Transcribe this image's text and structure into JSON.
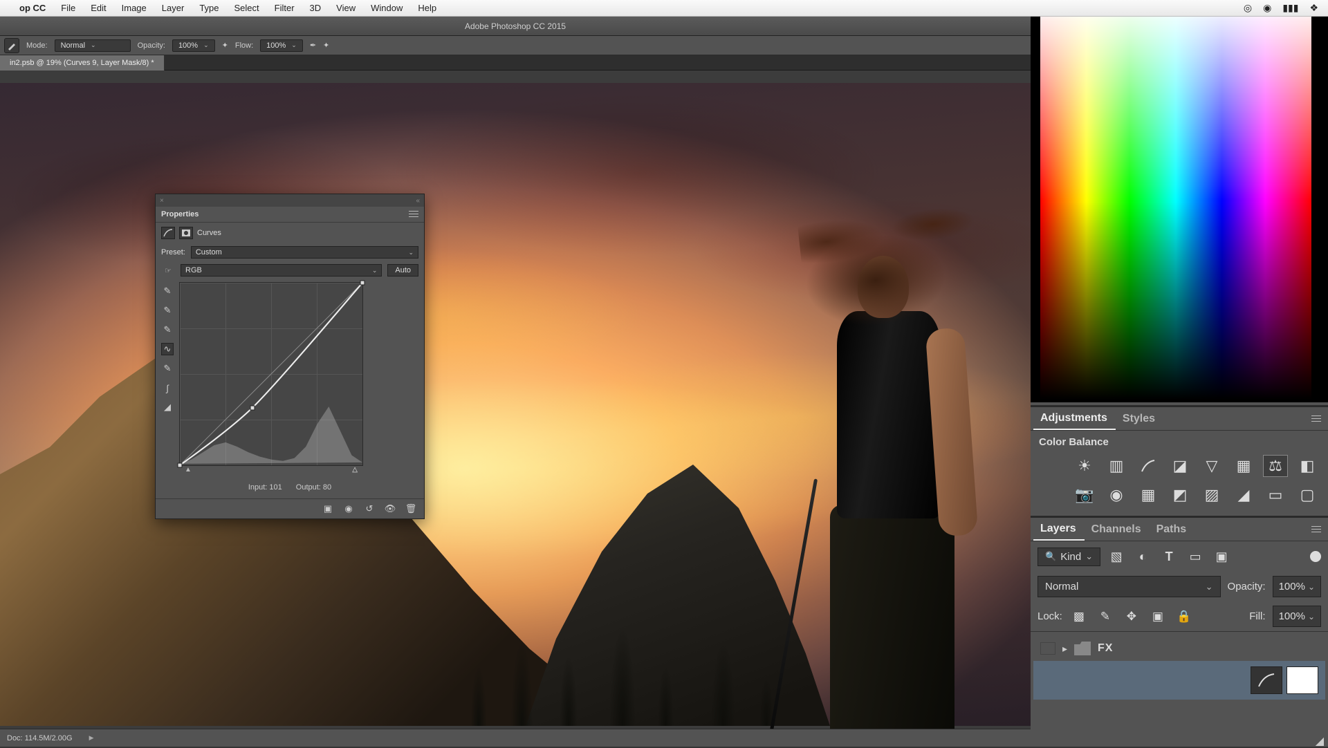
{
  "menu": {
    "apple": "",
    "items": [
      "op CC",
      "File",
      "Edit",
      "Image",
      "Layer",
      "Type",
      "Select",
      "Filter",
      "3D",
      "View",
      "Window",
      "Help"
    ],
    "status": [
      "◎",
      "◉",
      "▮▮▮",
      "❖"
    ]
  },
  "titlebar": "Adobe Photoshop CC 2015",
  "options": {
    "mode_lbl": "Mode:",
    "mode": "Normal",
    "opacity_lbl": "Opacity:",
    "opacity": "100%",
    "flow_lbl": "Flow:",
    "flow": "100%"
  },
  "doc_tab": "in2.psb @ 19% (Curves 9, Layer Mask/8) *",
  "statusbar": {
    "doc": "Doc: 114.5M/2.00G"
  },
  "props": {
    "title": "Properties",
    "type": "Curves",
    "preset_lbl": "Preset:",
    "preset": "Custom",
    "channel": "RGB",
    "auto": "Auto",
    "input_lbl": "Input:",
    "input": "101",
    "output_lbl": "Output:",
    "output": "80"
  },
  "adjustments": {
    "tab1": "Adjustments",
    "tab2": "Styles",
    "hover": "Color Balance"
  },
  "layers": {
    "tab1": "Layers",
    "tab2": "Channels",
    "tab3": "Paths",
    "kind": "Kind",
    "blend": "Normal",
    "opacity_lbl": "Opacity:",
    "opacity": "100%",
    "lock_lbl": "Lock:",
    "fill_lbl": "Fill:",
    "fill": "100%",
    "group": "FX"
  },
  "chart_data": {
    "type": "line",
    "title": "Curves — RGB",
    "xlabel": "Input",
    "ylabel": "Output",
    "xlim": [
      0,
      255
    ],
    "ylim": [
      0,
      255
    ],
    "series": [
      {
        "name": "curve",
        "x": [
          0,
          101,
          255
        ],
        "y": [
          0,
          80,
          255
        ]
      },
      {
        "name": "baseline",
        "x": [
          0,
          255
        ],
        "y": [
          0,
          255
        ]
      }
    ],
    "histogram": {
      "x": [
        0,
        16,
        32,
        48,
        64,
        80,
        96,
        112,
        128,
        144,
        160,
        176,
        192,
        208,
        224,
        240,
        255
      ],
      "y": [
        2,
        8,
        18,
        28,
        32,
        26,
        18,
        12,
        8,
        6,
        10,
        26,
        58,
        82,
        48,
        14,
        4
      ]
    }
  }
}
